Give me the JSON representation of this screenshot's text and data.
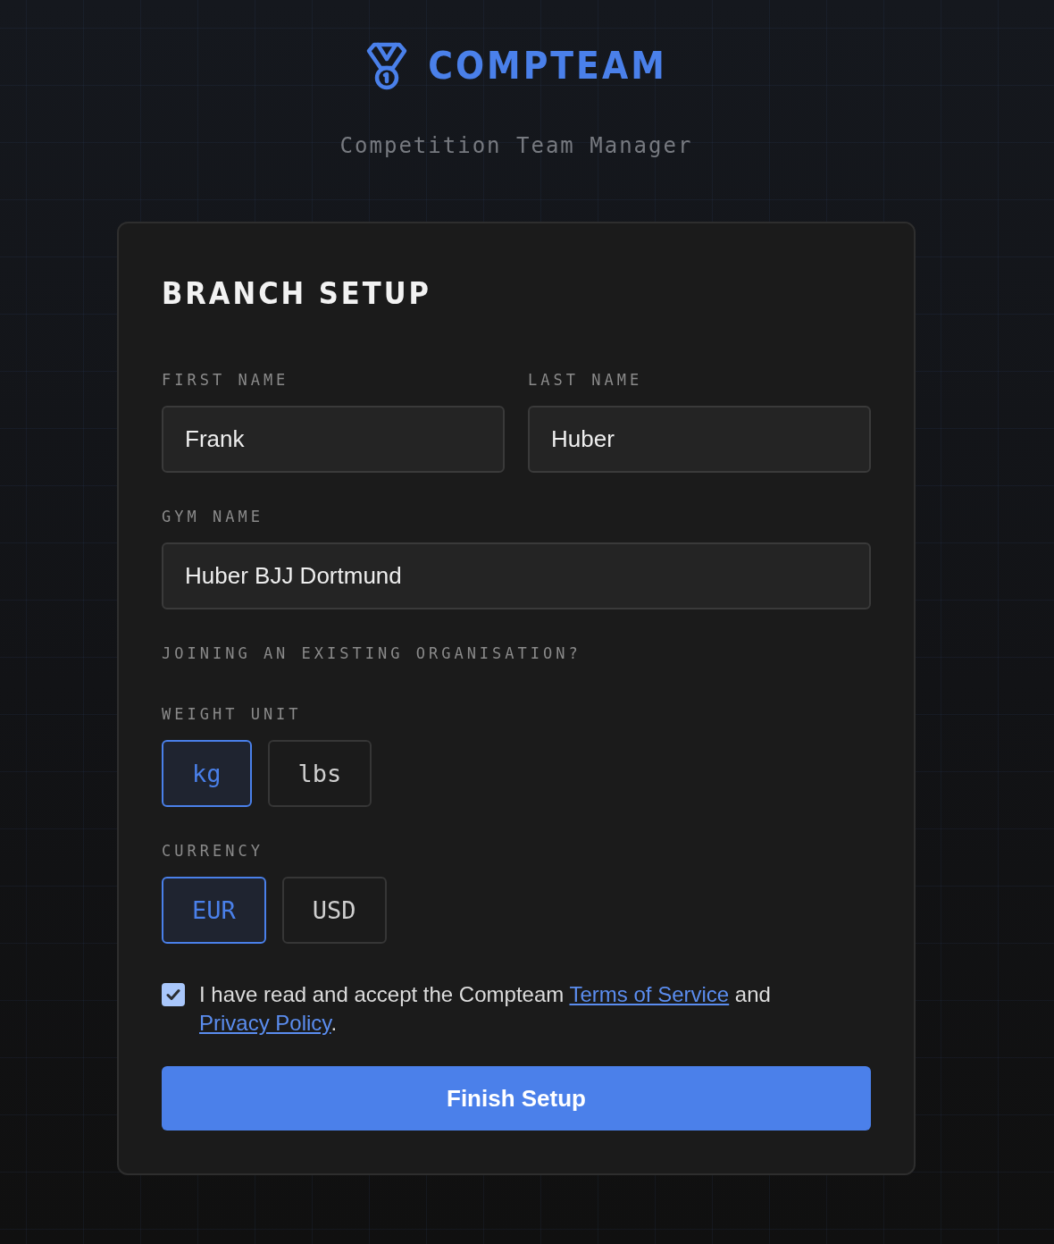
{
  "brand": {
    "name": "COMPTEAM",
    "tagline": "Competition Team Manager"
  },
  "form": {
    "title": "BRANCH SETUP",
    "name_fields": [
      {
        "label": "FIRST NAME",
        "value": "Frank"
      },
      {
        "label": "LAST NAME",
        "value": "Huber"
      }
    ],
    "gym_field": {
      "label": "GYM NAME",
      "value": "Huber BJJ Dortmund"
    },
    "join_link": "JOINING AN EXISTING ORGANISATION?",
    "option_groups": [
      {
        "label": "WEIGHT UNIT",
        "options": [
          {
            "label": "kg",
            "selected": true
          },
          {
            "label": "lbs",
            "selected": false
          }
        ]
      },
      {
        "label": "CURRENCY",
        "options": [
          {
            "label": "EUR",
            "selected": true
          },
          {
            "label": "USD",
            "selected": false
          }
        ]
      }
    ],
    "consent": {
      "checked": true,
      "text_before": "I have read and accept the Compteam ",
      "terms_link": "Terms of Service",
      "text_middle": " and ",
      "privacy_link": "Privacy Policy",
      "text_after": "."
    },
    "submit_button": "Finish Setup"
  }
}
